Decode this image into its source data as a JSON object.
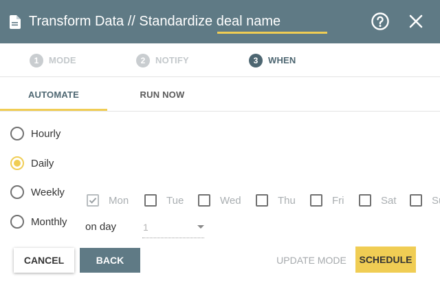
{
  "header": {
    "title": "Transform Data // Standardize deal name"
  },
  "steps": [
    {
      "num": "1",
      "label": "MODE"
    },
    {
      "num": "2",
      "label": "NOTIFY"
    },
    {
      "num": "3",
      "label": "WHEN"
    }
  ],
  "tabs": {
    "automate": "AUTOMATE",
    "run_now": "RUN NOW"
  },
  "frequency": {
    "selected": "Daily",
    "options": [
      "Hourly",
      "Daily",
      "Weekly",
      "Monthly"
    ]
  },
  "weekdays": [
    {
      "label": "Mon",
      "checked": true
    },
    {
      "label": "Tue",
      "checked": false
    },
    {
      "label": "Wed",
      "checked": false
    },
    {
      "label": "Thu",
      "checked": false
    },
    {
      "label": "Fri",
      "checked": false
    },
    {
      "label": "Sat",
      "checked": false
    },
    {
      "label": "Sun",
      "checked": false
    }
  ],
  "monthly": {
    "on_day_label": "on day",
    "day_value": "1"
  },
  "buttons": {
    "cancel": "CANCEL",
    "back": "BACK",
    "update_mode": "UPDATE MODE",
    "schedule": "SCHEDULE"
  },
  "colors": {
    "header_bg": "#5f7a85",
    "accent": "#f0cd54",
    "active_text": "#4d6671"
  },
  "icons": {
    "title": "document-icon",
    "help": "help-circle-icon",
    "close": "close-icon"
  }
}
